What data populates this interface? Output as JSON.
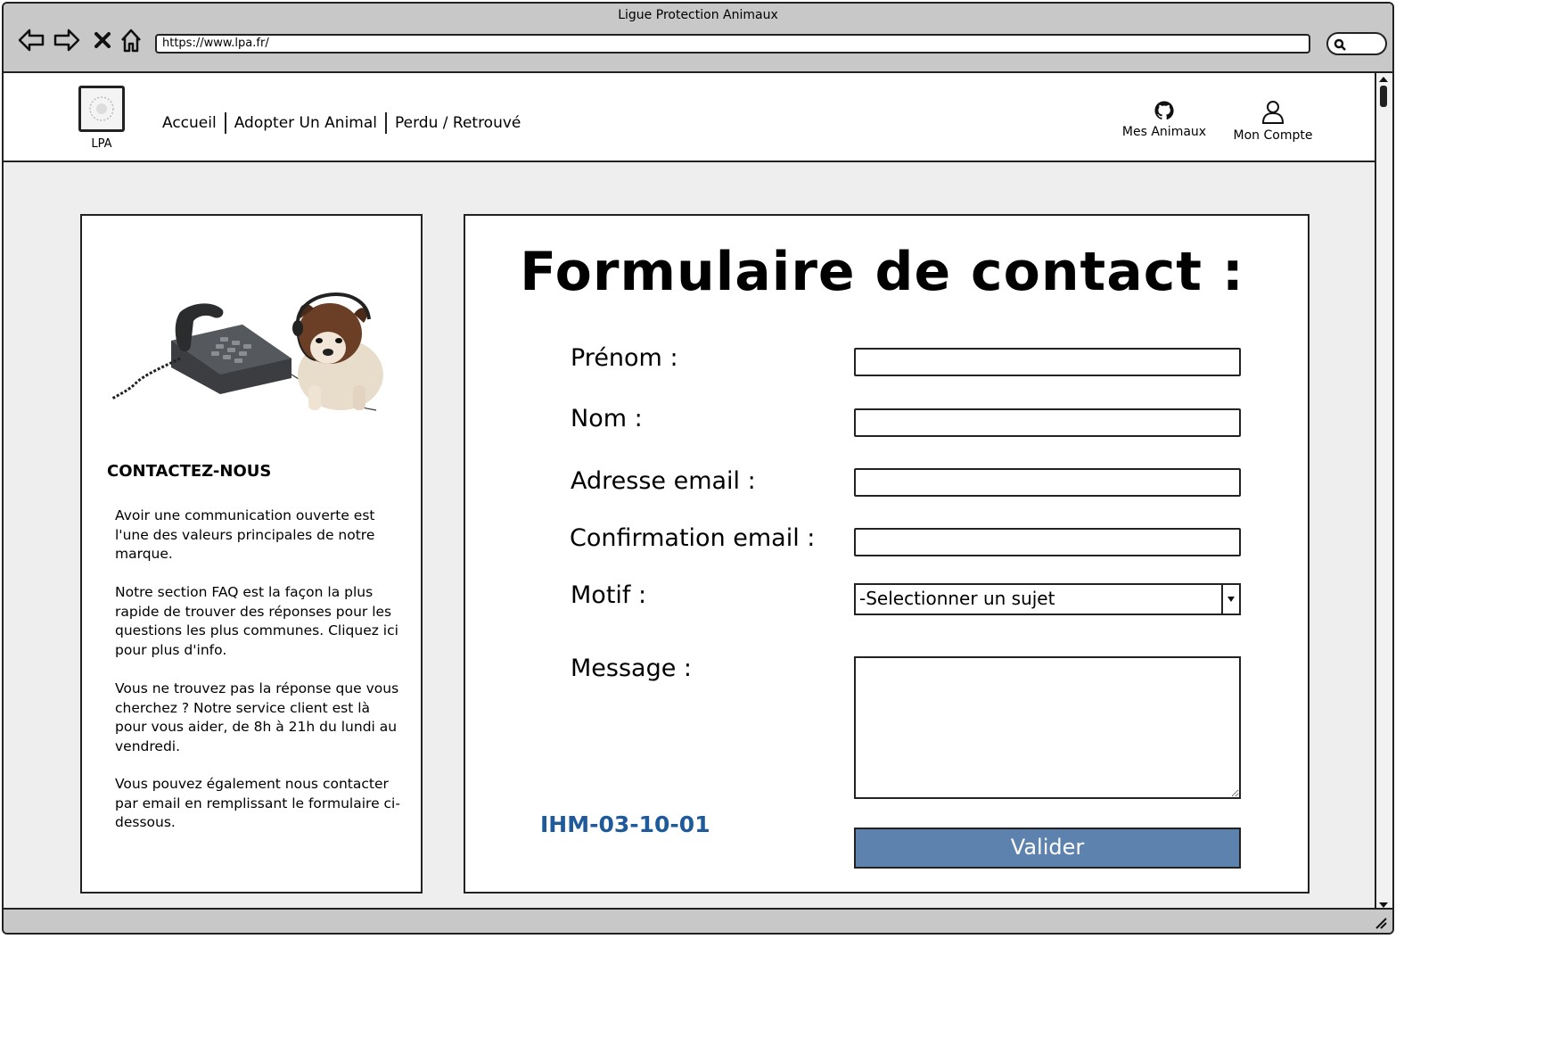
{
  "window": {
    "title": "Ligue Protection Animaux",
    "url": "https://www.lpa.fr/"
  },
  "header": {
    "logo_label": "LPA",
    "nav": [
      "Accueil",
      "Adopter Un Animal",
      "Perdu / Retrouvé"
    ],
    "my_pets_label": "Mes Animaux",
    "account_label": "Mon Compte"
  },
  "sidebar": {
    "title": "CONTACTEZ-NOUS",
    "paragraphs": [
      "Avoir une communication ouverte est l'une des valeurs principales de notre marque.",
      "Notre section FAQ est la façon la plus rapide de trouver des réponses pour les questions les plus communes. Cliquez ici pour plus d'info.",
      "Vous ne trouvez pas la réponse que vous cherchez ? Notre service client est là pour vous aider, de 8h à 21h du lundi au vendredi.",
      "Vous pouvez également nous contacter par email en remplissant le formulaire ci-dessous."
    ]
  },
  "form": {
    "title": "Formulaire de contact :",
    "labels": {
      "first_name": "Prénom :",
      "last_name": "Nom :",
      "email": "Adresse email :",
      "email_confirm": "Confirmation email :",
      "reason": "Motif :",
      "message": "Message :"
    },
    "values": {
      "first_name": "",
      "last_name": "",
      "email": "",
      "email_confirm": "",
      "message": ""
    },
    "reason_selected": "-Selectionner un sujet",
    "submit_label": "Valider",
    "screen_ref": "IHM-03-10-01"
  },
  "colors": {
    "submit_bg": "#5d82ae",
    "ref_text": "#1f5a9b",
    "page_bg": "#eeeeee"
  }
}
